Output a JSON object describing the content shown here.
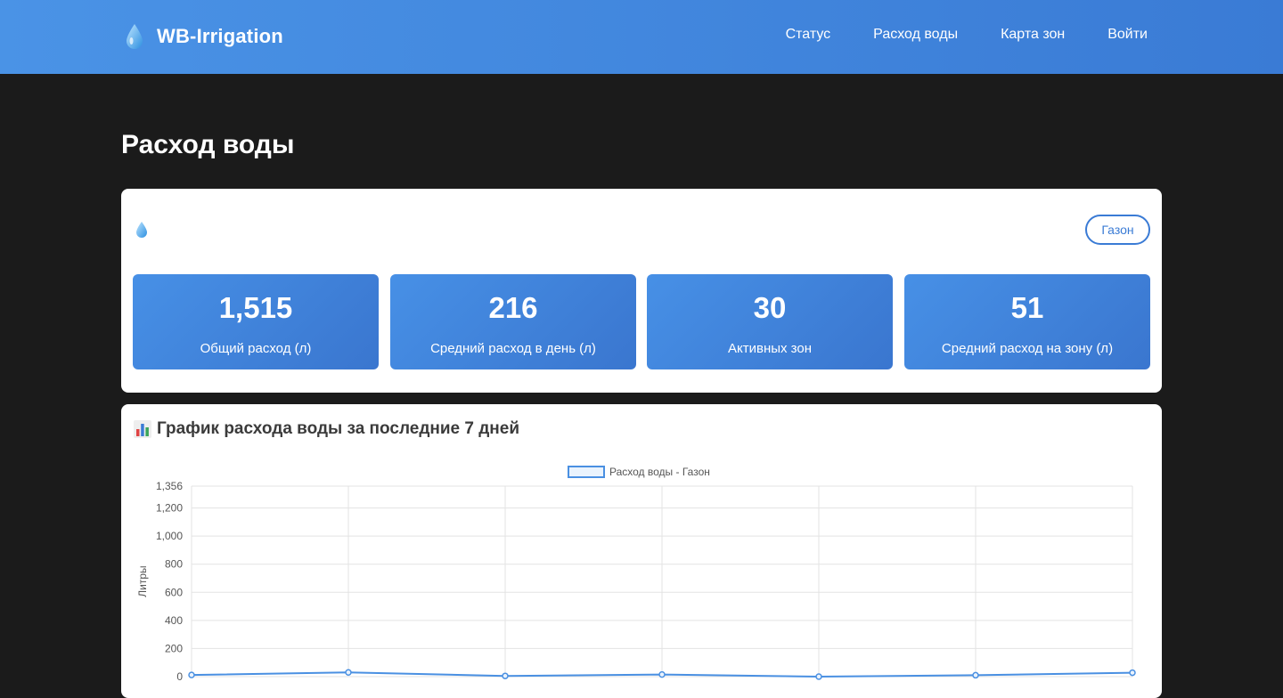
{
  "nav": {
    "brand": "WB-Irrigation",
    "links": [
      "Статус",
      "Расход воды",
      "Карта зон",
      "Войти"
    ]
  },
  "page": {
    "title": "Расход воды"
  },
  "stats_card": {
    "zone_button": "Газон",
    "stats": [
      {
        "value": "1,515",
        "label": "Общий расход (л)"
      },
      {
        "value": "216",
        "label": "Средний расход в день (л)"
      },
      {
        "value": "30",
        "label": "Активных зон"
      },
      {
        "value": "51",
        "label": "Средний расход на зону (л)"
      }
    ]
  },
  "chart_card": {
    "title": "График расхода воды за последние 7 дней"
  },
  "colors": {
    "accent": "#3a7bd5",
    "line": "#4a90e2",
    "background": "#1b1b1b"
  },
  "icons": [
    "water-drop-icon",
    "bar-chart-icon"
  ],
  "chart_data": {
    "type": "line",
    "title": "",
    "xlabel": "",
    "ylabel": "Литры",
    "legend_position": "top",
    "grid": true,
    "ylim": [
      0,
      1356
    ],
    "yticks": [
      "1,356",
      "1,200",
      "1,000",
      "800",
      "600",
      "400",
      "200",
      "0"
    ],
    "yticks_values": [
      1356,
      1200,
      1000,
      800,
      600,
      400,
      200,
      0
    ],
    "series": [
      {
        "name": "Расход воды - Газон",
        "values": [
          12,
          30,
          5,
          15,
          0,
          10,
          28
        ]
      }
    ]
  }
}
